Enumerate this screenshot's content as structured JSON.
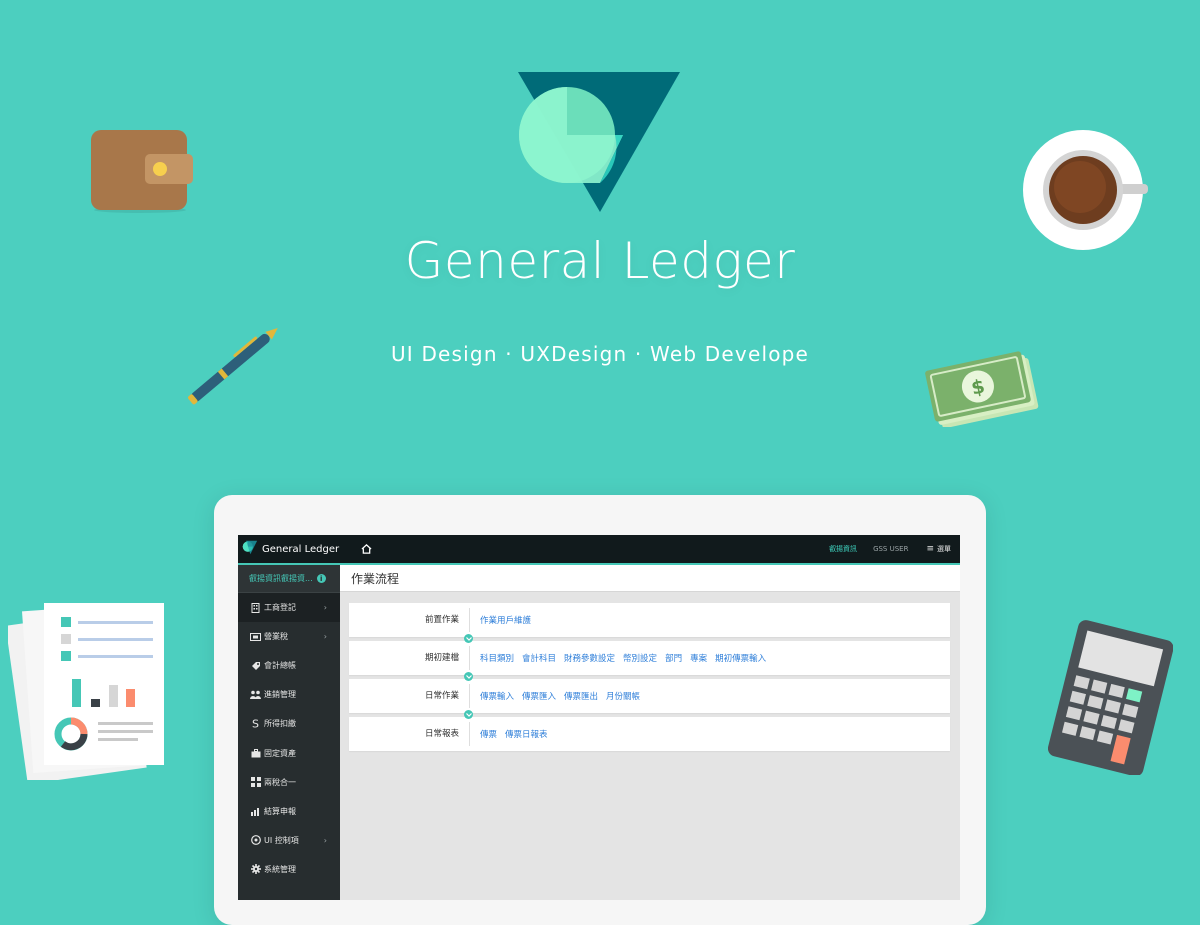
{
  "hero": {
    "title": "General Ledger",
    "subtitle": "UI Design · UXDesign · Web Develope"
  },
  "colors": {
    "background": "#4ccfbf",
    "accent": "#45c7b6",
    "logo_dark": "#006b78",
    "link": "#2f7fd9"
  },
  "app": {
    "brand": "General Ledger",
    "home_icon": "home-icon",
    "company_link": "叡揚資訊",
    "user": "GSS USER",
    "menu_label": "選單",
    "company_name": "叡揚資訊叡揚資...",
    "sidebar": [
      {
        "label": "工商登記",
        "icon": "building-icon",
        "has_children": true,
        "active": true
      },
      {
        "label": "營業稅",
        "icon": "ticket-icon",
        "has_children": true,
        "active": false
      },
      {
        "label": "會計總帳",
        "icon": "tag-icon",
        "has_children": false,
        "active": false
      },
      {
        "label": "進銷管理",
        "icon": "users-icon",
        "has_children": false,
        "active": false
      },
      {
        "label": "所得扣繳",
        "icon": "dollar-icon",
        "has_children": false,
        "active": false
      },
      {
        "label": "固定資產",
        "icon": "briefcase-icon",
        "has_children": false,
        "active": false
      },
      {
        "label": "兩稅合一",
        "icon": "grid-icon",
        "has_children": false,
        "active": false
      },
      {
        "label": "結算申報",
        "icon": "chart-icon",
        "has_children": false,
        "active": false
      },
      {
        "label": "UI 控制項",
        "icon": "palette-icon",
        "has_children": true,
        "active": false
      },
      {
        "label": "系統管理",
        "icon": "gear-icon",
        "has_children": false,
        "active": false
      }
    ],
    "page_title": "作業流程",
    "flow": [
      {
        "label": "前置作業",
        "links": [
          "作業用戶維護"
        ]
      },
      {
        "label": "期初建檔",
        "links": [
          "科目類別",
          "會計科目",
          "財務參數設定",
          "幣別設定",
          "部門",
          "專案",
          "期初傳票輸入"
        ]
      },
      {
        "label": "日常作業",
        "links": [
          "傳票輸入",
          "傳票匯入",
          "傳票匯出",
          "月份關帳"
        ]
      },
      {
        "label": "日常報表",
        "links": [
          "傳票",
          "傳票日報表"
        ]
      }
    ]
  }
}
